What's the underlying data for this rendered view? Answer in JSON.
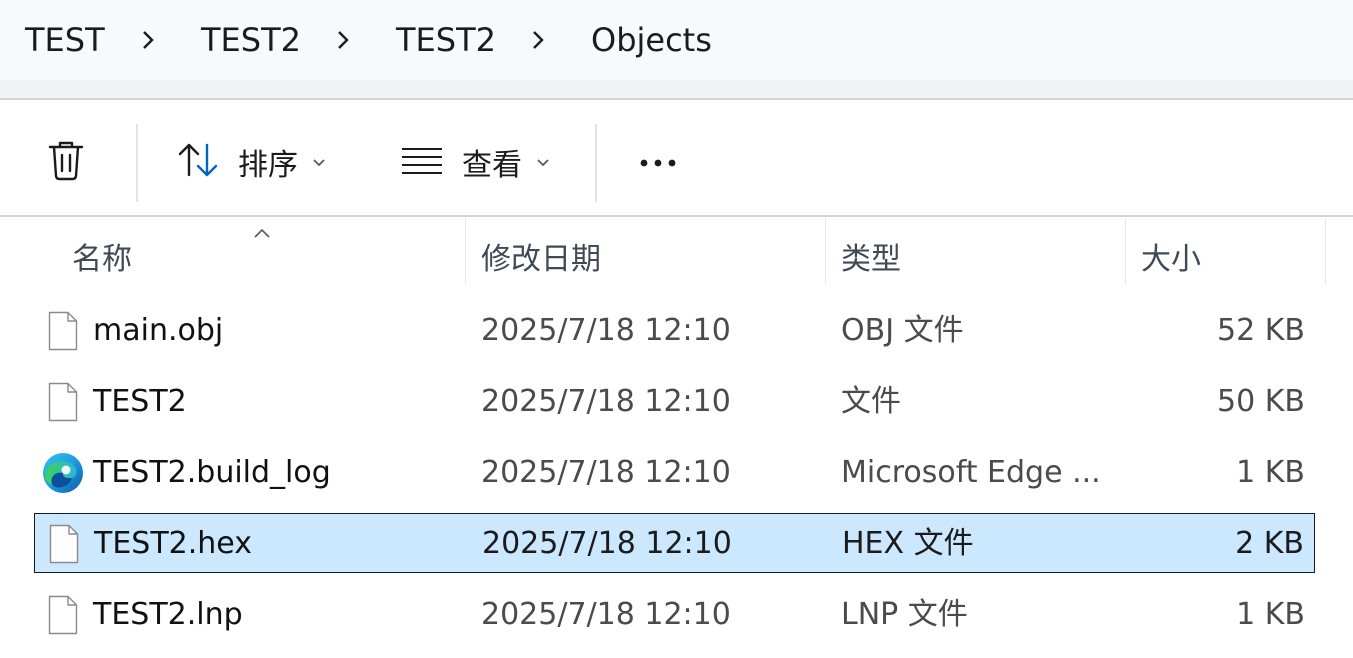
{
  "breadcrumb": {
    "items": [
      "TEST",
      "TEST2",
      "TEST2",
      "Objects"
    ],
    "separator_icon": "chevron-right-icon"
  },
  "toolbar": {
    "delete_icon": "trash-icon",
    "sort_label": "排序",
    "sort_icon": "sort-arrows-icon",
    "view_label": "查看",
    "view_icon": "list-lines-icon",
    "more_icon": "more-dots-icon"
  },
  "columns": {
    "name": "名称",
    "date": "修改日期",
    "type": "类型",
    "size": "大小",
    "sort_indicator_icon": "chevron-up-icon"
  },
  "files": [
    {
      "name": "main.obj",
      "date": "2025/7/18 12:10",
      "type": "OBJ 文件",
      "size": "52 KB",
      "icon": "generic-file-icon",
      "selected": false
    },
    {
      "name": "TEST2",
      "date": "2025/7/18 12:10",
      "type": "文件",
      "size": "50 KB",
      "icon": "generic-file-icon",
      "selected": false
    },
    {
      "name": "TEST2.build_log",
      "date": "2025/7/18 12:10",
      "type": "Microsoft Edge ...",
      "size": "1 KB",
      "icon": "edge-browser-icon",
      "selected": false
    },
    {
      "name": "TEST2.hex",
      "date": "2025/7/18 12:10",
      "type": "HEX 文件",
      "size": "2 KB",
      "icon": "generic-file-icon",
      "selected": true
    },
    {
      "name": "TEST2.lnp",
      "date": "2025/7/18 12:10",
      "type": "LNP 文件",
      "size": "1 KB",
      "icon": "generic-file-icon",
      "selected": false
    }
  ],
  "colors": {
    "selection_fill": "#cce8ff",
    "selection_border": "#0f1b2b",
    "accent": "#0067c0"
  }
}
